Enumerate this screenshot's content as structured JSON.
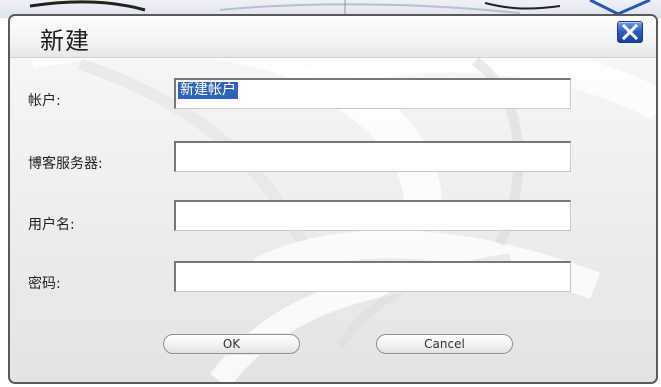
{
  "window": {
    "title": "新建"
  },
  "icons": {
    "close": "close-icon"
  },
  "form": {
    "account": {
      "label": "帐户:",
      "value": "新建帐户"
    },
    "blog_server": {
      "label": "博客服务器:",
      "value": ""
    },
    "username": {
      "label": "用户名:",
      "value": ""
    },
    "password": {
      "label": "密码:",
      "value": ""
    }
  },
  "buttons": {
    "ok": "OK",
    "cancel": "Cancel"
  },
  "colors": {
    "selection": "#2f63b8",
    "close_button": "#2f5fc0",
    "dialog_border": "#5a5a5a"
  }
}
